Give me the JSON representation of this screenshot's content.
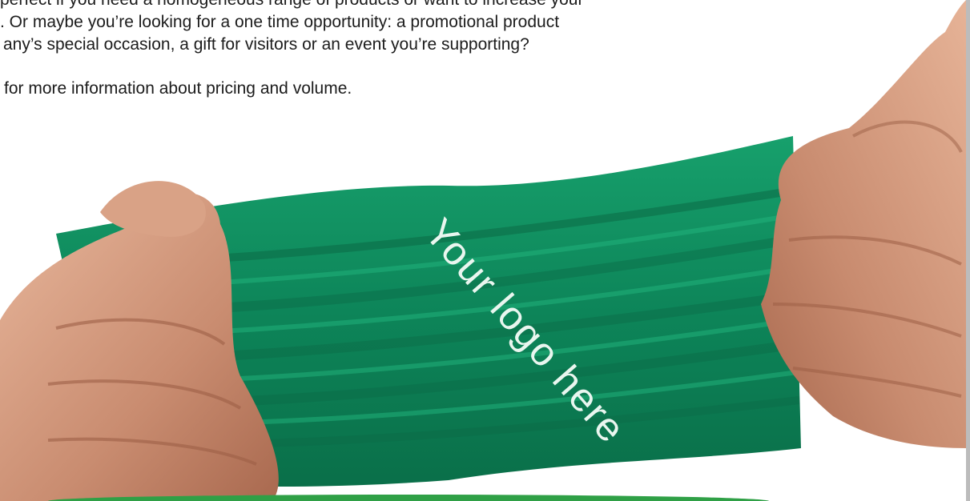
{
  "intro": {
    "line1": "perfect if you need a homogeneous range of products or want to increase your",
    "line2": ". Or maybe you’re looking for a one time opportunity: a promotional product",
    "line3": "any’s special occasion, a gift for visitors or an event you’re supporting?",
    "line4": "for more information about pricing and volume."
  },
  "image": {
    "band_text": "Your logo here",
    "band_color": "#0f8a5e"
  }
}
